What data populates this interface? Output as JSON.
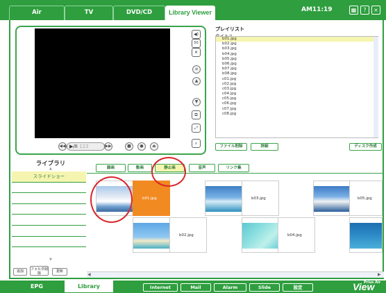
{
  "top_tabs": [
    "Air",
    "TV",
    "DVD/CD",
    "Library Viewer"
  ],
  "clock": "AM11:19",
  "top_buttons": [
    "?",
    "?",
    "×"
  ],
  "player": {
    "play_label": "▶/II",
    "counter": "123"
  },
  "playlist": {
    "title": "プレイリスト",
    "column_header": "タイトル",
    "items": [
      "b01.jpg",
      "b02.jpg",
      "b03.jpg",
      "b04.jpg",
      "b05.jpg",
      "b06.jpg",
      "b07.jpg",
      "b08.jpg",
      "c01.jpg",
      "c02.jpg",
      "c03.jpg",
      "c04.jpg",
      "c05.jpg",
      "c06.jpg",
      "c07.jpg",
      "c08.jpg"
    ],
    "selected_index": 0,
    "buttons": {
      "delete": "ファイル削除",
      "detail": "詳細",
      "make_disc": "ディスク作成"
    }
  },
  "library": {
    "title": "ライブラリ",
    "items": [
      "スライドショー",
      "",
      "",
      "",
      "",
      "",
      ""
    ],
    "selected_index": 0,
    "buttons": {
      "add": "追加",
      "delete_folder": "フォルダ削除",
      "refresh": "更新"
    }
  },
  "categories": [
    "録画",
    "動画",
    "静止画",
    "音声",
    "リンク集"
  ],
  "active_category": 2,
  "thumbnails": [
    {
      "label": "b01.jpg",
      "row": 0,
      "col": 0,
      "highlight": true
    },
    {
      "label": "b02.jpg",
      "row": 1,
      "col": 1
    },
    {
      "label": "b03.jpg",
      "row": 0,
      "col": 2
    },
    {
      "label": "b04.jpg",
      "row": 1,
      "col": 3
    },
    {
      "label": "b05.jpg",
      "row": 0,
      "col": 4
    }
  ],
  "bottom_tabs": [
    "EPG",
    "Library"
  ],
  "bottom_buttons": [
    "Internet",
    "Mail",
    "Alarm",
    "Slide",
    "設定"
  ],
  "logo": "View",
  "logo_small": "Prius Air",
  "colors": {
    "brand_green": "#2e9e3e",
    "highlight_yellow": "#f6f5b0",
    "callout_red": "#d8262a",
    "selected_orange": "#f28a22"
  }
}
